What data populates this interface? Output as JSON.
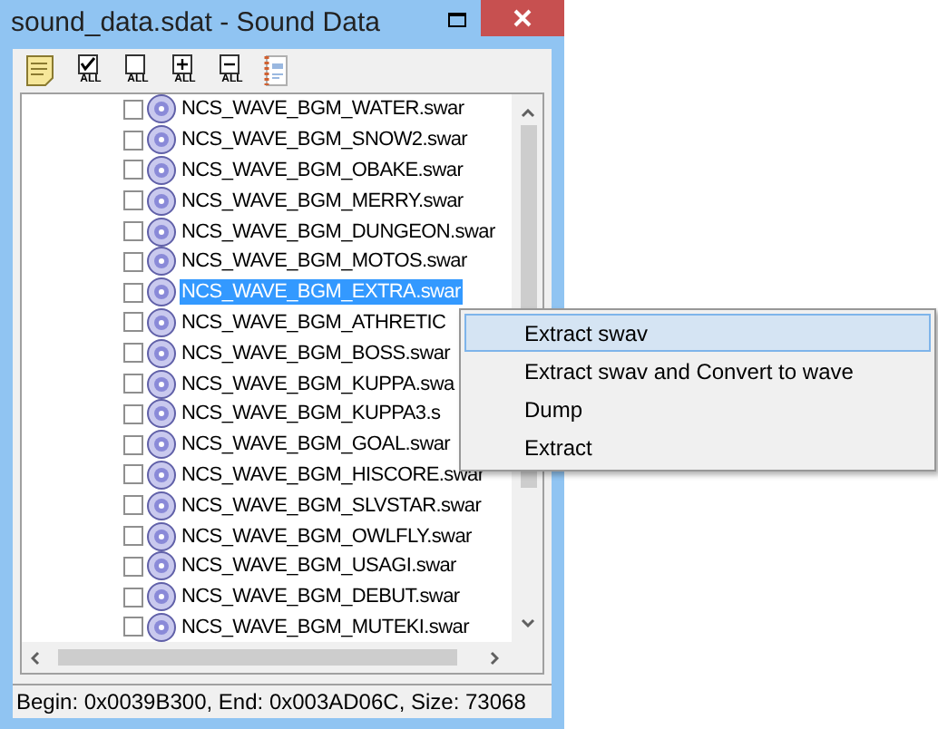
{
  "window": {
    "title": "sound_data.sdat - Sound Data"
  },
  "toolbar": [
    {
      "kind": "note"
    },
    {
      "kind": "check",
      "label": "ALL"
    },
    {
      "kind": "uncheck",
      "label": "ALL"
    },
    {
      "kind": "expand",
      "label": "ALL"
    },
    {
      "kind": "collapse",
      "label": "ALL"
    },
    {
      "kind": "book"
    }
  ],
  "tree": {
    "items": [
      {
        "label": "NCS_WAVE_BGM_WATER.swar",
        "checked": false,
        "selected": false
      },
      {
        "label": "NCS_WAVE_BGM_SNOW2.swar",
        "checked": false,
        "selected": false
      },
      {
        "label": "NCS_WAVE_BGM_OBAKE.swar",
        "checked": false,
        "selected": false
      },
      {
        "label": "NCS_WAVE_BGM_MERRY.swar",
        "checked": false,
        "selected": false
      },
      {
        "label": "NCS_WAVE_BGM_DUNGEON.swar",
        "checked": false,
        "selected": false
      },
      {
        "label": "NCS_WAVE_BGM_MOTOS.swar",
        "checked": false,
        "selected": false
      },
      {
        "label": "NCS_WAVE_BGM_EXTRA.swar",
        "checked": false,
        "selected": true
      },
      {
        "label": "NCS_WAVE_BGM_ATHRETIC",
        "checked": false,
        "selected": false
      },
      {
        "label": "NCS_WAVE_BGM_BOSS.swar",
        "checked": false,
        "selected": false
      },
      {
        "label": "NCS_WAVE_BGM_KUPPA.swa",
        "checked": false,
        "selected": false
      },
      {
        "label": "NCS_WAVE_BGM_KUPPA3.s",
        "checked": false,
        "selected": false
      },
      {
        "label": "NCS_WAVE_BGM_GOAL.swar",
        "checked": false,
        "selected": false
      },
      {
        "label": "NCS_WAVE_BGM_HISCORE.swar",
        "checked": false,
        "selected": false
      },
      {
        "label": "NCS_WAVE_BGM_SLVSTAR.swar",
        "checked": false,
        "selected": false
      },
      {
        "label": "NCS_WAVE_BGM_OWLFLY.swar",
        "checked": false,
        "selected": false
      },
      {
        "label": "NCS_WAVE_BGM_USAGI.swar",
        "checked": false,
        "selected": false
      },
      {
        "label": "NCS_WAVE_BGM_DEBUT.swar",
        "checked": false,
        "selected": false
      },
      {
        "label": "NCS_WAVE_BGM_MUTEKI.swar",
        "checked": false,
        "selected": false
      }
    ]
  },
  "status_bar": "Begin: 0x0039B300, End: 0x003AD06C, Size: 73068",
  "context_menu": [
    {
      "label": "Extract swav",
      "selected": true
    },
    {
      "label": "Extract swav and Convert to wave",
      "selected": false
    },
    {
      "label": "Dump",
      "selected": false
    },
    {
      "label": "Extract",
      "selected": false
    }
  ]
}
